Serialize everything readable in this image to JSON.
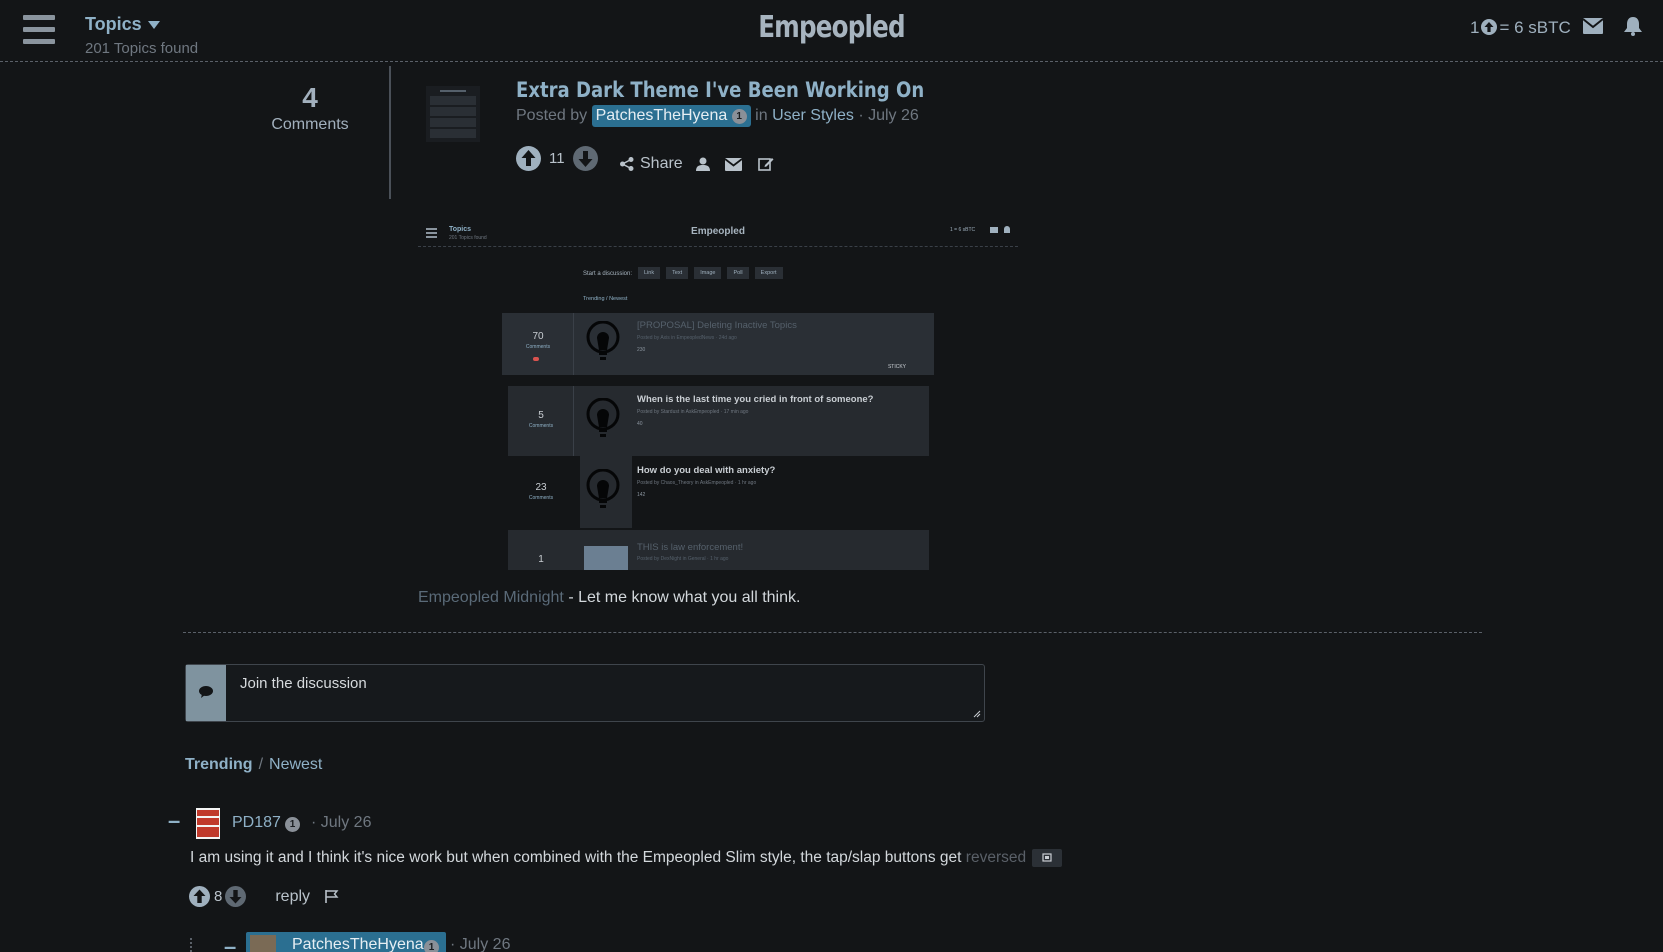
{
  "header": {
    "topics_label": "Topics",
    "topics_found": "201 Topics found",
    "site_title": "Empeopled",
    "rate_prefix": "1",
    "rate_suffix": "= 6 sBTC"
  },
  "post": {
    "comment_count": "4",
    "comments_label": "Comments",
    "title": "Extra Dark Theme I've Been Working On",
    "posted_by": "Posted by",
    "author": "PatchesTheHyena",
    "author_level": "1",
    "in_label": "in",
    "category": "User Styles",
    "date": "· July 26",
    "votes": "11",
    "share_label": "Share",
    "caption_link": "Empeopled Midnight",
    "caption_text": " - Let me know what you all think."
  },
  "preview": {
    "topics": "Topics",
    "found": "201 Topics found",
    "site": "Empeopled",
    "rate": "1 = 6 sBTC",
    "start": "Start a discussion:",
    "buttons": [
      "Link",
      "Text",
      "Image",
      "Poll",
      "Export"
    ],
    "sort": "Trending / Newest",
    "items": [
      {
        "count": "70",
        "label": "Comments",
        "title": "[PROPOSAL] Deleting Inactive Topics",
        "meta": "Posted by Axis in EmpeopledNews · 24d ago",
        "votes": "230",
        "sticky": "STICKY"
      },
      {
        "count": "5",
        "label": "Comments",
        "title": "When is the last time you cried in front of someone?",
        "meta": "Posted by Stardust in AskEmpeopled · 17 min ago",
        "votes": "40"
      },
      {
        "count": "23",
        "label": "Comments",
        "title": "How do you deal with anxiety?",
        "meta": "Posted by Chaos_Theory in AskEmpeopled · 1 hr ago",
        "votes": "142"
      },
      {
        "count": "1",
        "label": "",
        "title": "THIS is law enforcement!",
        "meta": "Posted by DexNight in General · 1 hr ago",
        "votes": ""
      }
    ]
  },
  "composer": {
    "placeholder": "Join the discussion"
  },
  "sort": {
    "trending": "Trending",
    "slash": "/",
    "newest": "Newest"
  },
  "comments": [
    {
      "collapse": "–",
      "user": "PD187",
      "level": "1",
      "date": "· July 26",
      "text": "I am using it and I think it's nice work but when combined with the Empeopled Slim style, the tap/slap buttons get",
      "text_dim": "reversed",
      "votes": "8",
      "reply": "reply"
    },
    {
      "collapse": "–",
      "user": "PatchesTheHyena",
      "level": "1",
      "date": "· July 26"
    }
  ],
  "colors": {
    "background": "#131517",
    "accent": "#8fb1c7",
    "user_chip": "#2b6f91"
  }
}
